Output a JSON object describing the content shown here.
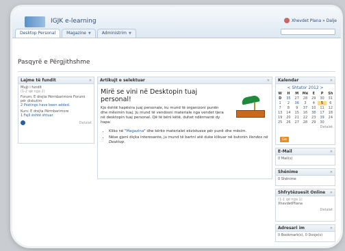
{
  "header": {
    "app_title": "IGJK e-learning",
    "user": "Xhevdet Plana » Dalje"
  },
  "tabs": [
    {
      "label": "Desktop Personal"
    },
    {
      "label": "Magazine"
    },
    {
      "label": "Administrim"
    }
  ],
  "page": {
    "title": "Pasqyrë e Përgjithshme"
  },
  "left_panel": {
    "title": "Lajme të fundit",
    "subtitle": "Mujji i fundit",
    "range": "(1-2 që nga 2)",
    "item1_text": "Forum: E drejta Përmbarimore Forumi për diskutim",
    "item1_link": "2 Postings have been added.",
    "item2_text": "Kurs: E drejta Përmbarimore",
    "item2_link": "1 Fajll është shtuar.",
    "footer": "Detalet"
  },
  "center_panel": {
    "title": "Artikujt e selektuar",
    "welcome": "Mirë se vini në Desktopin tuaj personal!",
    "paragraph": "Kjo është hapësira juaj personale, ku mund të organizoni punën dhe mësimin tuaj. Ju mund të vendosni materiale nga vendet tjera në desktopin tuaj personal. Që të bëni këtë, duhet ndërmarrë dy hapa:",
    "bullet1_prefix": "Kliko në \"",
    "bullet1_link": "Magazina",
    "bullet1_suffix": "\" dhe kërko materialet ekzistuese për punë dhe mësim.",
    "bullet2_prefix": "Nëse gjeni diçka interesante, ju mund të bartni atë duke klikuar në butonin ",
    "bullet2_em": "Vendos në Desktop",
    "bullet2_suffix": "."
  },
  "calendar": {
    "title": "Kalendar",
    "month_label": "< Shtator 2012 >",
    "headers": [
      "W",
      "H",
      "M",
      "Më",
      "E",
      "P",
      "Sh",
      "D"
    ],
    "rows": [
      [
        "35",
        "27",
        "28",
        "29",
        "30",
        "31",
        "1",
        "2"
      ],
      [
        "36",
        "3",
        "4",
        "5",
        "6",
        "7",
        "8",
        "9"
      ],
      [
        "37",
        "10",
        "11",
        "12",
        "13",
        "14",
        "15",
        "16"
      ],
      [
        "38",
        "17",
        "18",
        "19",
        "20",
        "21",
        "22",
        "23"
      ],
      [
        "39",
        "24",
        "25",
        "26",
        "27",
        "28",
        "29",
        "30"
      ]
    ],
    "today": "5",
    "footer": "Detalet",
    "go_button": "Go"
  },
  "email_panel": {
    "title": "E-Mail",
    "value": "0 Mail(s)"
  },
  "shenime_panel": {
    "title": "Shënime",
    "value": "0 Shënime"
  },
  "users_panel": {
    "title": "Shfrytëzuesit Online",
    "range": "(1-1 që nga 1)",
    "user": "XhevdetPllana",
    "footer": "Detalet"
  },
  "adresari_panel": {
    "title": "Adresari im",
    "value": "0 Bookmark(s), 0 Dosje(s)"
  }
}
